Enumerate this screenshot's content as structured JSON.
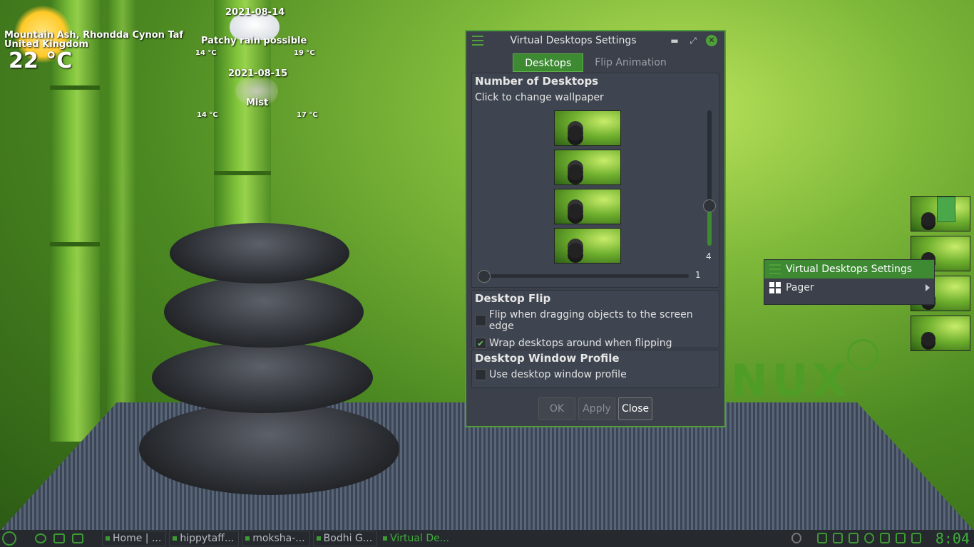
{
  "weather": {
    "location_line1": "Mountain Ash, Rhondda Cynon Taf",
    "location_line2": "United Kingdom",
    "temperature": "22 °C",
    "day1": {
      "date": "2021-08-14",
      "condition": "Patchy rain possible",
      "low": "14 °C",
      "high": "19 °C"
    },
    "day2": {
      "date": "2021-08-15",
      "condition": "Mist",
      "low": "14 °C",
      "high": "17 °C"
    }
  },
  "wallpaper_text": "NUX",
  "dialog": {
    "title": "Virtual Desktops Settings",
    "tabs": [
      {
        "label": "Desktops"
      },
      {
        "label": "Flip Animation"
      }
    ],
    "number_section": {
      "heading": "Number of Desktops",
      "hint": "Click to change wallpaper",
      "vertical_value": "4",
      "horizontal_value": "1"
    },
    "flip_section": {
      "heading": "Desktop Flip",
      "options": [
        {
          "label": "Flip when dragging objects to the screen edge",
          "checked": false
        },
        {
          "label": "Wrap desktops around when flipping",
          "checked": true
        }
      ]
    },
    "profile_section": {
      "heading": "Desktop Window Profile",
      "option": {
        "label": "Use desktop window profile",
        "checked": false
      }
    },
    "buttons": {
      "ok": "OK",
      "apply": "Apply",
      "close": "Close"
    }
  },
  "context_menu": {
    "items": [
      {
        "label": "Virtual Desktops Settings",
        "icon": "settings-sliders-icon",
        "highlighted": true
      },
      {
        "label": "Pager",
        "icon": "grid-icon",
        "has_submenu": true
      }
    ]
  },
  "taskbar": {
    "tasks": [
      {
        "label": "Home | ..."
      },
      {
        "label": "hippytaff..."
      },
      {
        "label": "moksha-..."
      },
      {
        "label": "Bodhi G..."
      },
      {
        "label": "Virtual De..."
      }
    ],
    "clock": "8:04"
  },
  "colors": {
    "accent": "#3d8a33",
    "dialog_bg": "#3b404a",
    "taskbar_bg": "#262a2f"
  }
}
